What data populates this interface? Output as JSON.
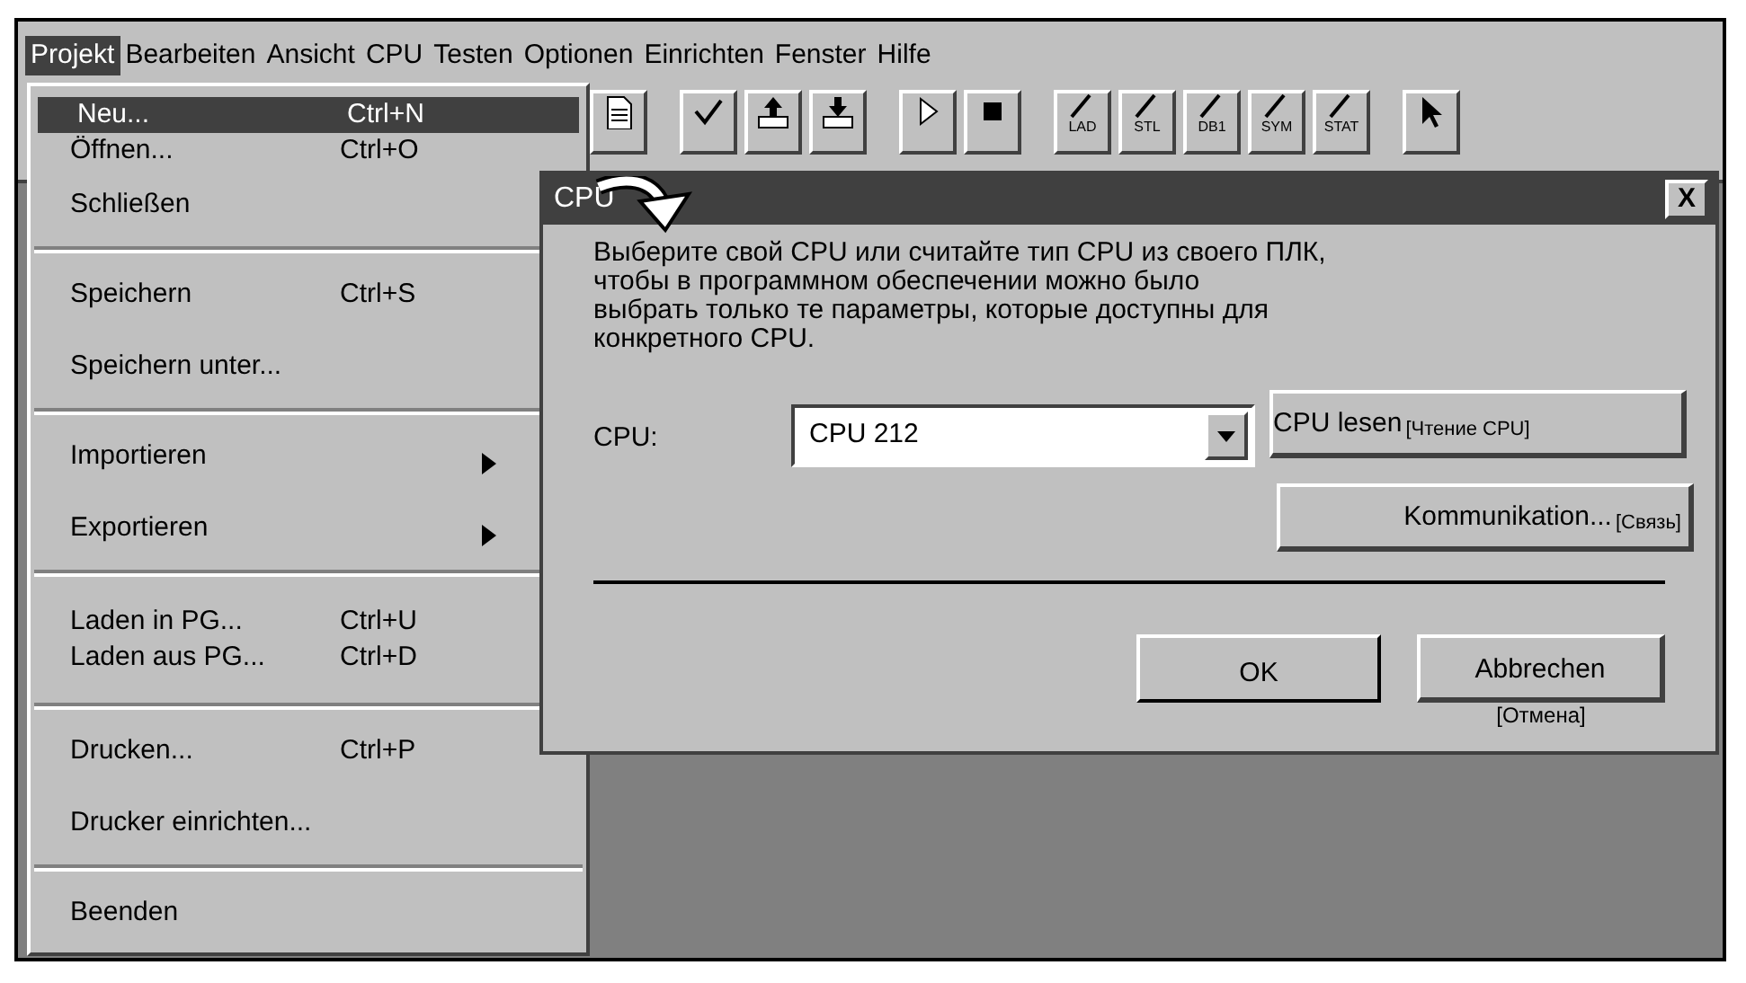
{
  "menu_bar": [
    {
      "label": "Projekt",
      "selected": true
    },
    {
      "label": "Bearbeiten",
      "selected": false
    },
    {
      "label": "Ansicht",
      "selected": false
    },
    {
      "label": "CPU",
      "selected": false
    },
    {
      "label": "Testen",
      "selected": false
    },
    {
      "label": "Optionen",
      "selected": false
    },
    {
      "label": "Einrichten",
      "selected": false
    },
    {
      "label": "Fenster",
      "selected": false
    },
    {
      "label": "Hilfe",
      "selected": false
    }
  ],
  "toolbar": [
    {
      "kind": "page"
    },
    {
      "kind": "gap"
    },
    {
      "kind": "check"
    },
    {
      "kind": "upload"
    },
    {
      "kind": "download"
    },
    {
      "kind": "gap"
    },
    {
      "kind": "play"
    },
    {
      "kind": "stop"
    },
    {
      "kind": "gap"
    },
    {
      "kind": "label",
      "label": "LAD"
    },
    {
      "kind": "label",
      "label": "STL"
    },
    {
      "kind": "label",
      "label": "DB1"
    },
    {
      "kind": "label",
      "label": "SYM"
    },
    {
      "kind": "label",
      "label": "STAT"
    },
    {
      "kind": "gap"
    },
    {
      "kind": "pointer"
    }
  ],
  "menu": [
    {
      "kind": "tight",
      "label": "Neu...",
      "shortcut": "Ctrl+N",
      "selected": true
    },
    {
      "kind": "tight",
      "label": "Öffnen...",
      "shortcut": "Ctrl+O",
      "selected": false
    },
    {
      "kind": "item",
      "label": "Schließen",
      "selected": false
    },
    {
      "kind": "separator"
    },
    {
      "kind": "item",
      "label": "Speichern",
      "shortcut": "Ctrl+S",
      "selected": false
    },
    {
      "kind": "item",
      "label": "Speichern unter...",
      "selected": false
    },
    {
      "kind": "separator"
    },
    {
      "kind": "item",
      "label": "Importieren",
      "submenu": true,
      "selected": false
    },
    {
      "kind": "item",
      "label": "Exportieren",
      "submenu": true,
      "selected": false
    },
    {
      "kind": "separator"
    },
    {
      "kind": "gap"
    },
    {
      "kind": "tight",
      "label": "Laden in PG...",
      "shortcut": "Ctrl+U",
      "selected": false
    },
    {
      "kind": "tight",
      "label": "Laden aus PG...",
      "shortcut": "Ctrl+D",
      "selected": false
    },
    {
      "kind": "gap"
    },
    {
      "kind": "separator"
    },
    {
      "kind": "item",
      "label": "Drucken...",
      "shortcut": "Ctrl+P",
      "selected": false
    },
    {
      "kind": "item",
      "label": "Drucker einrichten...",
      "selected": false
    },
    {
      "kind": "separator"
    },
    {
      "kind": "item",
      "label": "Beenden",
      "selected": false
    }
  ],
  "dialog": {
    "title": "CPU",
    "close": "X",
    "message": "Выберите свой CPU или считайте тип CPU из своего ПЛК,\nчтобы в программном обеспечении можно было\nвыбрать только те параметры, которые доступны для\nконкретного CPU.",
    "cpu_label": "CPU:",
    "cpu_value": "CPU 212",
    "side_buttons": [
      {
        "label": "CPU lesen",
        "note": "[Чтение CPU]"
      },
      {
        "label": "Kommunikation...",
        "note": "[Связь]"
      }
    ],
    "ok": "OK",
    "cancel": "Abbrechen",
    "cancel_note": "[Отмена]"
  }
}
